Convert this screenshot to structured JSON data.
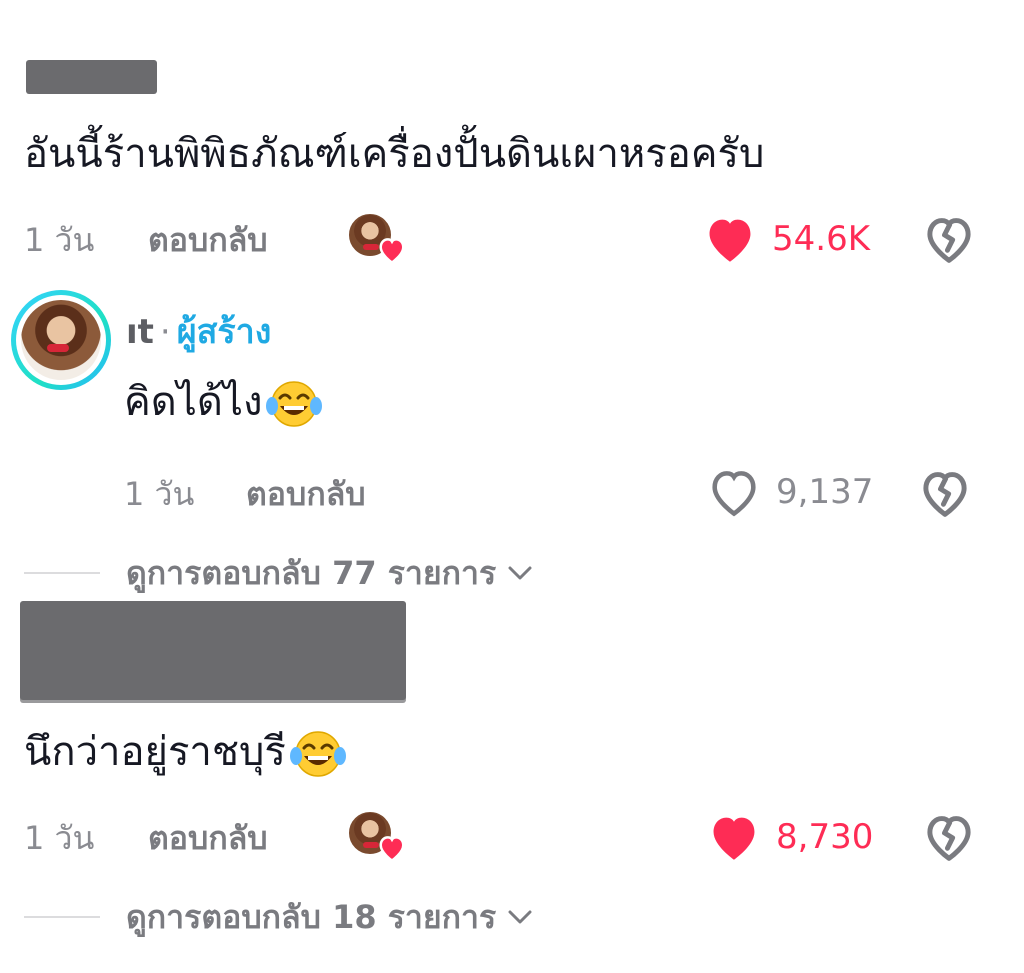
{
  "comments": [
    {
      "text": "อันนี้ร้านพิพิธภัณฑ์เครื่องปั้นดินเผาหรอครับ",
      "time": "1 วัน",
      "reply_label": "ตอบกลับ",
      "likes": "54.6K",
      "liked": true,
      "view_replies": "ดูการตอบกลับ 77 รายการ"
    },
    {
      "text": "นึกว่าอยู่ราชบุรี",
      "time": "1 วัน",
      "reply_label": "ตอบกลับ",
      "likes": "8,730",
      "liked": true,
      "view_replies": "ดูการตอบกลับ 18 รายการ"
    }
  ],
  "reply": {
    "author": "ıt",
    "separator": "·",
    "role": "ผู้สร้าง",
    "text": "คิดได้ไง",
    "time": "1 วัน",
    "reply_label": "ตอบกลับ",
    "likes": "9,137",
    "liked": false
  },
  "icons": {
    "like": "heart-icon",
    "dislike": "broken-heart-icon",
    "expand": "chevron-down-icon",
    "emoji": "laughing-tears-emoji"
  },
  "colors": {
    "like_active": "#fe2c55",
    "creator_accent": "#1fa9e3",
    "muted_text": "#8a8b91",
    "redaction": "#6b6b6e"
  }
}
